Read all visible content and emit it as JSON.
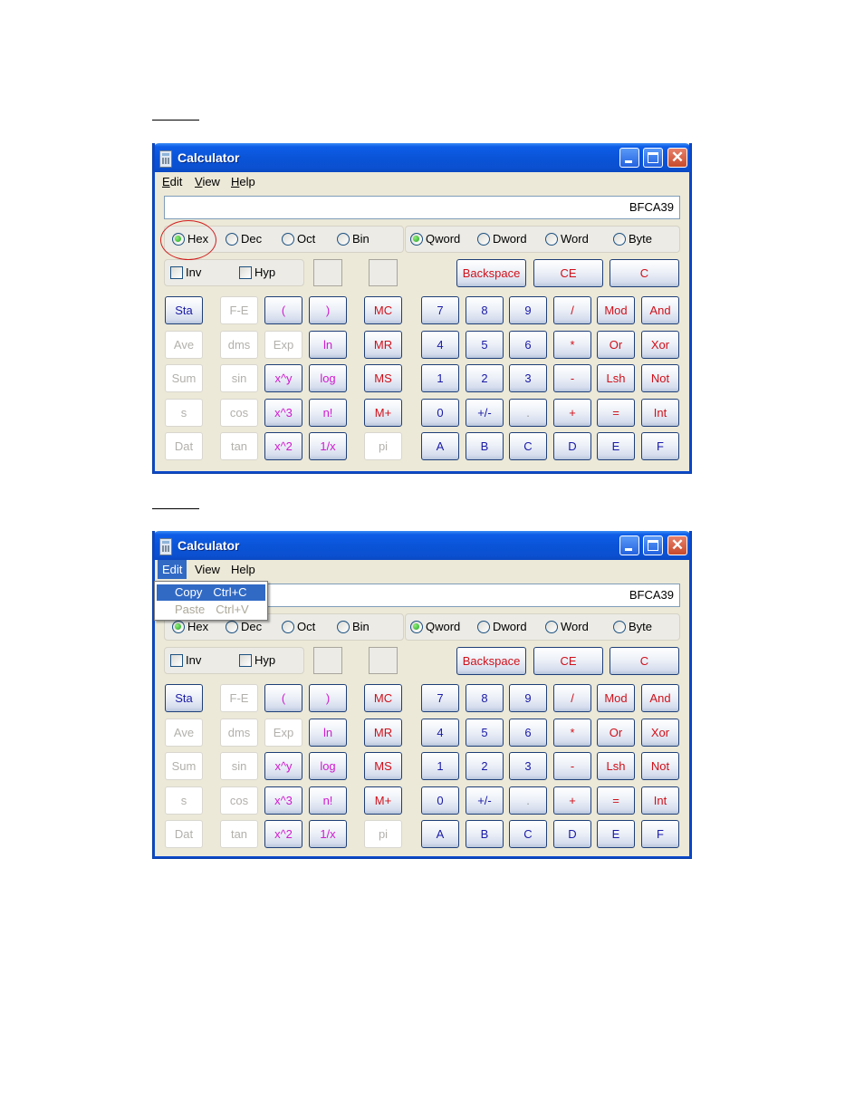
{
  "windows": [
    {
      "title": "Calculator",
      "menu": [
        {
          "label": "Edit",
          "accel": "E",
          "rest": "dit"
        },
        {
          "label": "View",
          "accel": "V",
          "rest": "iew"
        },
        {
          "label": "Help",
          "accel": "H",
          "rest": "elp"
        }
      ],
      "display_value": "BFCA39",
      "annotation": "Hex radio button circled in red"
    },
    {
      "title": "Calculator",
      "menu": [
        {
          "label": "Edit",
          "open": true
        },
        {
          "label": "View"
        },
        {
          "label": "Help"
        }
      ],
      "display_value": "BFCA39",
      "edit_menu": [
        {
          "label": "Copy",
          "shortcut": "Ctrl+C",
          "state": "highlighted"
        },
        {
          "label": "Paste",
          "shortcut": "Ctrl+V",
          "state": "disabled"
        }
      ]
    }
  ],
  "number_system": {
    "options": [
      "Hex",
      "Dec",
      "Oct",
      "Bin"
    ],
    "selected": "Hex"
  },
  "word_size": {
    "options": [
      "Qword",
      "Dword",
      "Word",
      "Byte"
    ],
    "selected": "Qword"
  },
  "checkboxes": [
    {
      "label": "Inv",
      "checked": false
    },
    {
      "label": "Hyp",
      "checked": false
    }
  ],
  "edit_buttons": [
    "Backspace",
    "CE",
    "C"
  ],
  "left_keys": [
    [
      {
        "label": "Sta",
        "style": "blue"
      },
      {
        "label": "F-E",
        "style": "disabled"
      },
      {
        "label": "(",
        "style": "magenta"
      },
      {
        "label": ")",
        "style": "magenta"
      },
      {
        "label": "MC",
        "style": "red"
      }
    ],
    [
      {
        "label": "Ave",
        "style": "disabled"
      },
      {
        "label": "dms",
        "style": "disabled"
      },
      {
        "label": "Exp",
        "style": "disabled"
      },
      {
        "label": "ln",
        "style": "magenta"
      },
      {
        "label": "MR",
        "style": "red"
      }
    ],
    [
      {
        "label": "Sum",
        "style": "disabled"
      },
      {
        "label": "sin",
        "style": "disabled"
      },
      {
        "label": "x^y",
        "style": "magenta"
      },
      {
        "label": "log",
        "style": "magenta"
      },
      {
        "label": "MS",
        "style": "red"
      }
    ],
    [
      {
        "label": "s",
        "style": "disabled"
      },
      {
        "label": "cos",
        "style": "disabled"
      },
      {
        "label": "x^3",
        "style": "magenta"
      },
      {
        "label": "n!",
        "style": "magenta"
      },
      {
        "label": "M+",
        "style": "red"
      }
    ],
    [
      {
        "label": "Dat",
        "style": "disabled"
      },
      {
        "label": "tan",
        "style": "disabled"
      },
      {
        "label": "x^2",
        "style": "magenta"
      },
      {
        "label": "1/x",
        "style": "magenta"
      },
      {
        "label": "pi",
        "style": "disabled"
      }
    ]
  ],
  "right_keys": [
    [
      {
        "label": "7",
        "style": "blue"
      },
      {
        "label": "8",
        "style": "blue"
      },
      {
        "label": "9",
        "style": "blue"
      },
      {
        "label": "/",
        "style": "red"
      },
      {
        "label": "Mod",
        "style": "red"
      },
      {
        "label": "And",
        "style": "red"
      }
    ],
    [
      {
        "label": "4",
        "style": "blue"
      },
      {
        "label": "5",
        "style": "blue"
      },
      {
        "label": "6",
        "style": "blue"
      },
      {
        "label": "*",
        "style": "red"
      },
      {
        "label": "Or",
        "style": "red"
      },
      {
        "label": "Xor",
        "style": "red"
      }
    ],
    [
      {
        "label": "1",
        "style": "blue"
      },
      {
        "label": "2",
        "style": "blue"
      },
      {
        "label": "3",
        "style": "blue"
      },
      {
        "label": "-",
        "style": "red"
      },
      {
        "label": "Lsh",
        "style": "red"
      },
      {
        "label": "Not",
        "style": "red"
      }
    ],
    [
      {
        "label": "0",
        "style": "blue"
      },
      {
        "label": "+/-",
        "style": "blue"
      },
      {
        "label": ".",
        "style": "disabled-btn"
      },
      {
        "label": "+",
        "style": "red"
      },
      {
        "label": "=",
        "style": "red"
      },
      {
        "label": "Int",
        "style": "red"
      }
    ],
    [
      {
        "label": "A",
        "style": "blue"
      },
      {
        "label": "B",
        "style": "blue"
      },
      {
        "label": "C",
        "style": "blue"
      },
      {
        "label": "D",
        "style": "blue"
      },
      {
        "label": "E",
        "style": "blue"
      },
      {
        "label": "F",
        "style": "blue"
      }
    ]
  ],
  "colors": {
    "title_bar": "#0a54d8",
    "highlight": "#316ac5",
    "key_blue": "#1a1aa6",
    "key_red": "#d0101a",
    "key_magenta": "#d01ad0",
    "annotation": "#d02020"
  }
}
